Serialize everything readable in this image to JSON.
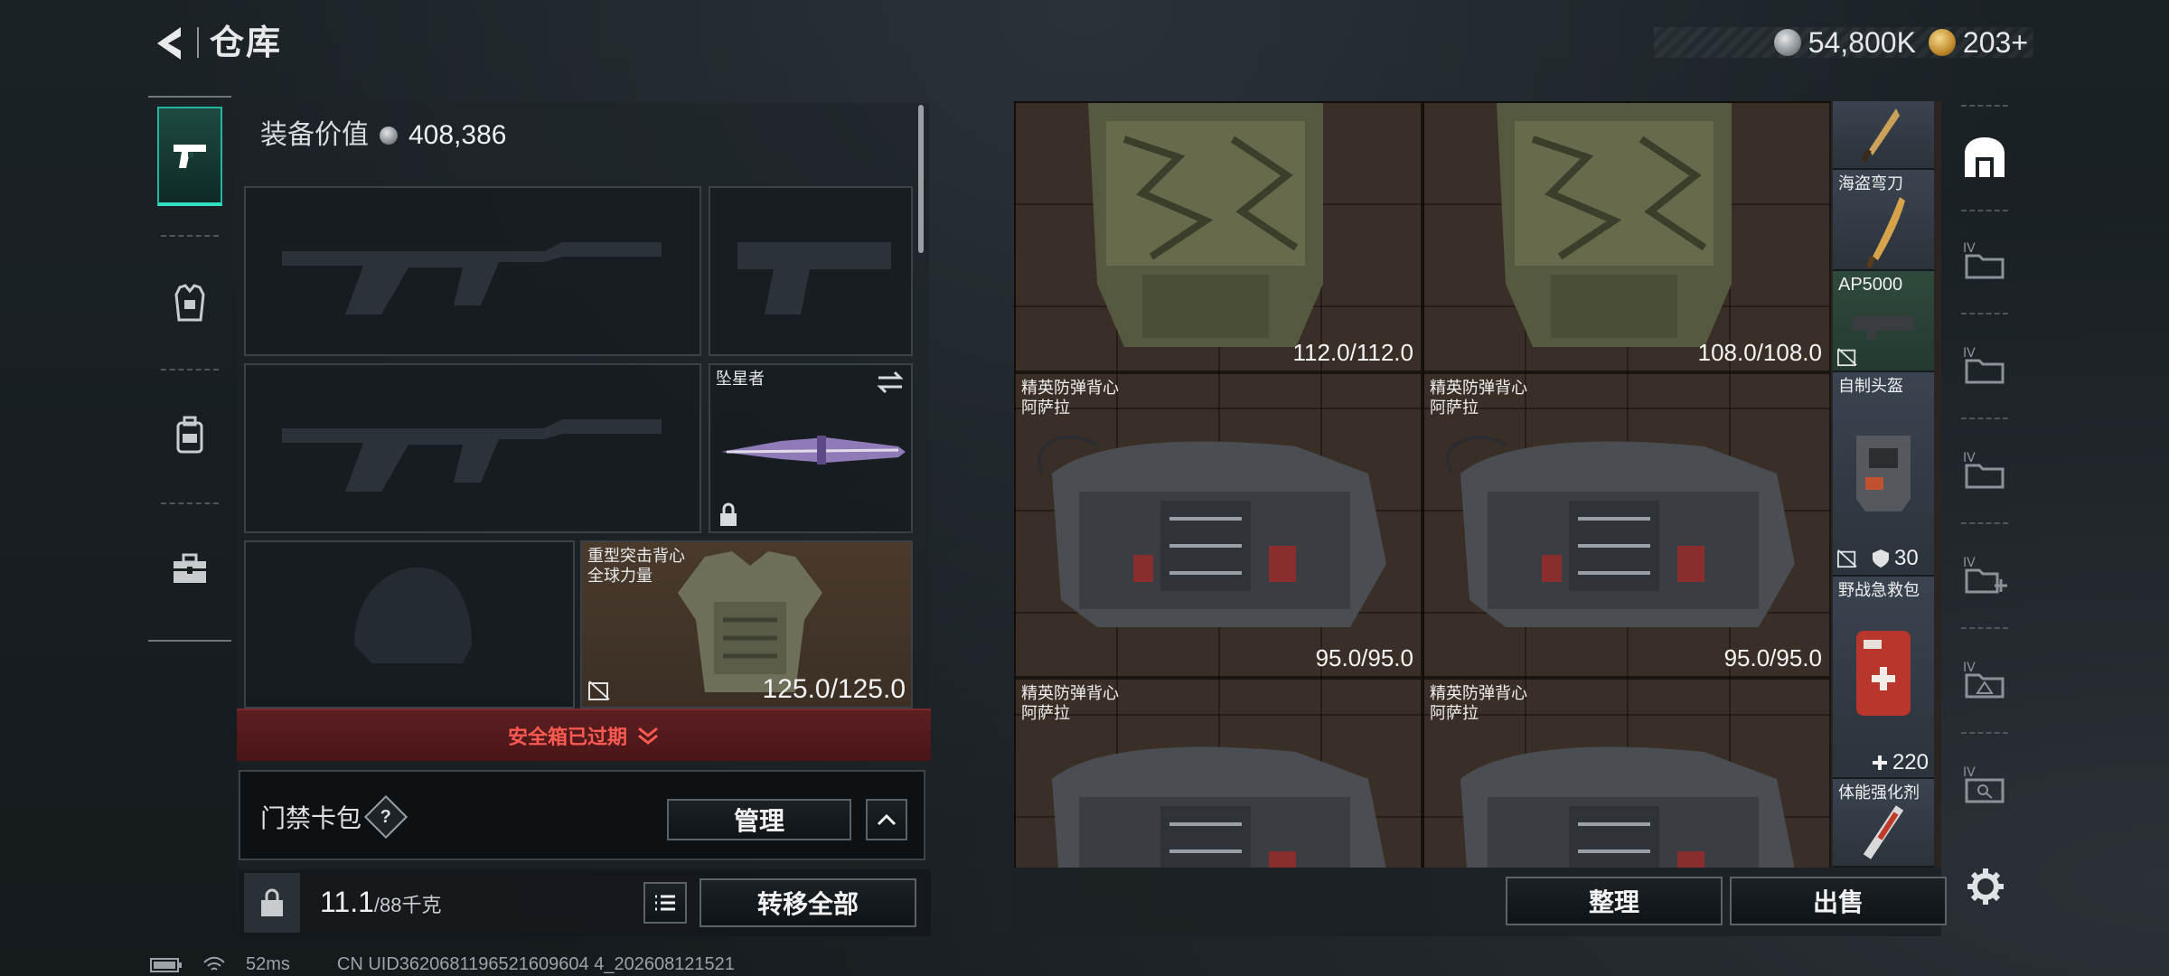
{
  "header": {
    "title": "仓库",
    "currencies": [
      {
        "icon": "silver-coin-icon",
        "value": "54,800K"
      },
      {
        "icon": "gold-coin-icon",
        "value": "203+"
      }
    ]
  },
  "left_rail": {
    "tabs": [
      {
        "name": "weapons-tab",
        "icon": "pistol-icon",
        "active": true
      },
      {
        "name": "armor-tab",
        "icon": "vest-icon",
        "active": false
      },
      {
        "name": "backpack-tab",
        "icon": "backpack-icon",
        "active": false
      },
      {
        "name": "supplies-tab",
        "icon": "toolbox-icon",
        "active": false
      }
    ]
  },
  "equipment": {
    "value_label": "装备价值",
    "value": "408,386",
    "slots": {
      "primary1": {
        "label": ""
      },
      "pistol": {
        "label": ""
      },
      "primary2": {
        "label": ""
      },
      "melee": {
        "label": "坠星者"
      },
      "helmet": {
        "label": ""
      },
      "armor": {
        "label": "重型突击背心\n全球力量",
        "durability": "125.0/125.0"
      }
    },
    "safebox_text": "安全箱已过期",
    "keycard_label": "门禁卡包",
    "keycard_help": "?",
    "manage_label": "管理",
    "weight_value": "11.1",
    "weight_max": "/88千克",
    "transfer_all_label": "转移全部"
  },
  "storage": {
    "cells": [
      {
        "label": "",
        "durability": "112.0/112.0"
      },
      {
        "label": "",
        "durability": "108.0/108.0"
      },
      {
        "label": "精英防弹背心\n阿萨拉",
        "durability": "95.0/95.0"
      },
      {
        "label": "精英防弹背心\n阿萨拉",
        "durability": "95.0/95.0"
      },
      {
        "label": "精英防弹背心\n阿萨拉",
        "durability": ""
      },
      {
        "label": "精英防弹背心\n阿萨拉",
        "durability": ""
      }
    ],
    "side_items": [
      {
        "label": ""
      },
      {
        "label": "海盗弯刀"
      },
      {
        "label": "AP5000"
      },
      {
        "label": "自制头盔",
        "badge": "30"
      },
      {
        "label": "野战急救包",
        "badge": "220"
      },
      {
        "label": "体能强化剂"
      }
    ],
    "sort_label": "整理",
    "sell_label": "出售"
  },
  "right_rail": {
    "tabs": [
      {
        "icon": "storage-home-icon"
      },
      {
        "icon": "folder-tab-1-icon"
      },
      {
        "icon": "folder-tab-2-icon"
      },
      {
        "icon": "folder-tab-3-icon"
      },
      {
        "icon": "add-folder-icon"
      },
      {
        "icon": "folder-tab-warning-icon"
      },
      {
        "icon": "folder-tab-search-icon"
      }
    ]
  },
  "status": {
    "ping": "52ms",
    "uid": "CN UID3620681196521609604 4_202608121521"
  }
}
